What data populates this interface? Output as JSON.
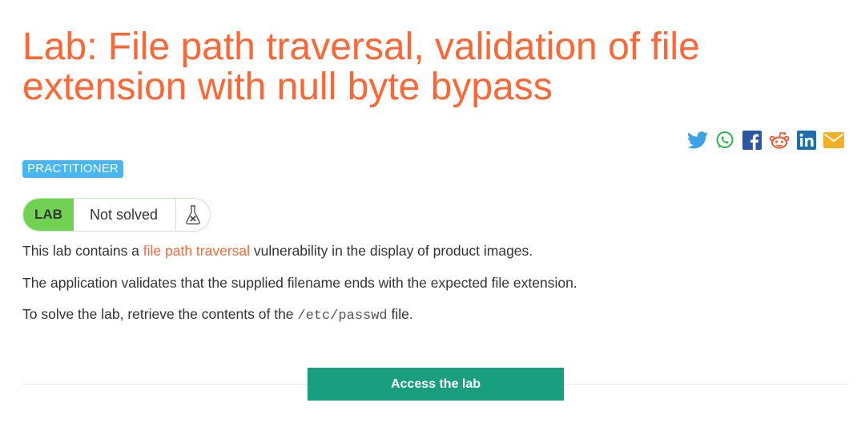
{
  "title": "Lab: File path traversal, validation of file extension with null byte bypass",
  "level_badge": "PRACTITIONER",
  "status": {
    "lab_label": "LAB",
    "state": "Not solved"
  },
  "share_icons": [
    "twitter-icon",
    "whatsapp-icon",
    "facebook-icon",
    "reddit-icon",
    "linkedin-icon",
    "email-icon"
  ],
  "description": {
    "p1_before": "This lab contains a ",
    "p1_link": "file path traversal",
    "p1_after": " vulnerability in the display of product images.",
    "p2": "The application validates that the supplied filename ends with the expected file extension.",
    "p3_before": "To solve the lab, retrieve the contents of the ",
    "p3_code": "/etc/passwd",
    "p3_after": " file."
  },
  "access_button": "Access the lab",
  "colors": {
    "title": "#ff6633",
    "badge": "#48b6f0",
    "lab": "#70d152",
    "button": "#1a9e80",
    "link": "#ff6633"
  }
}
